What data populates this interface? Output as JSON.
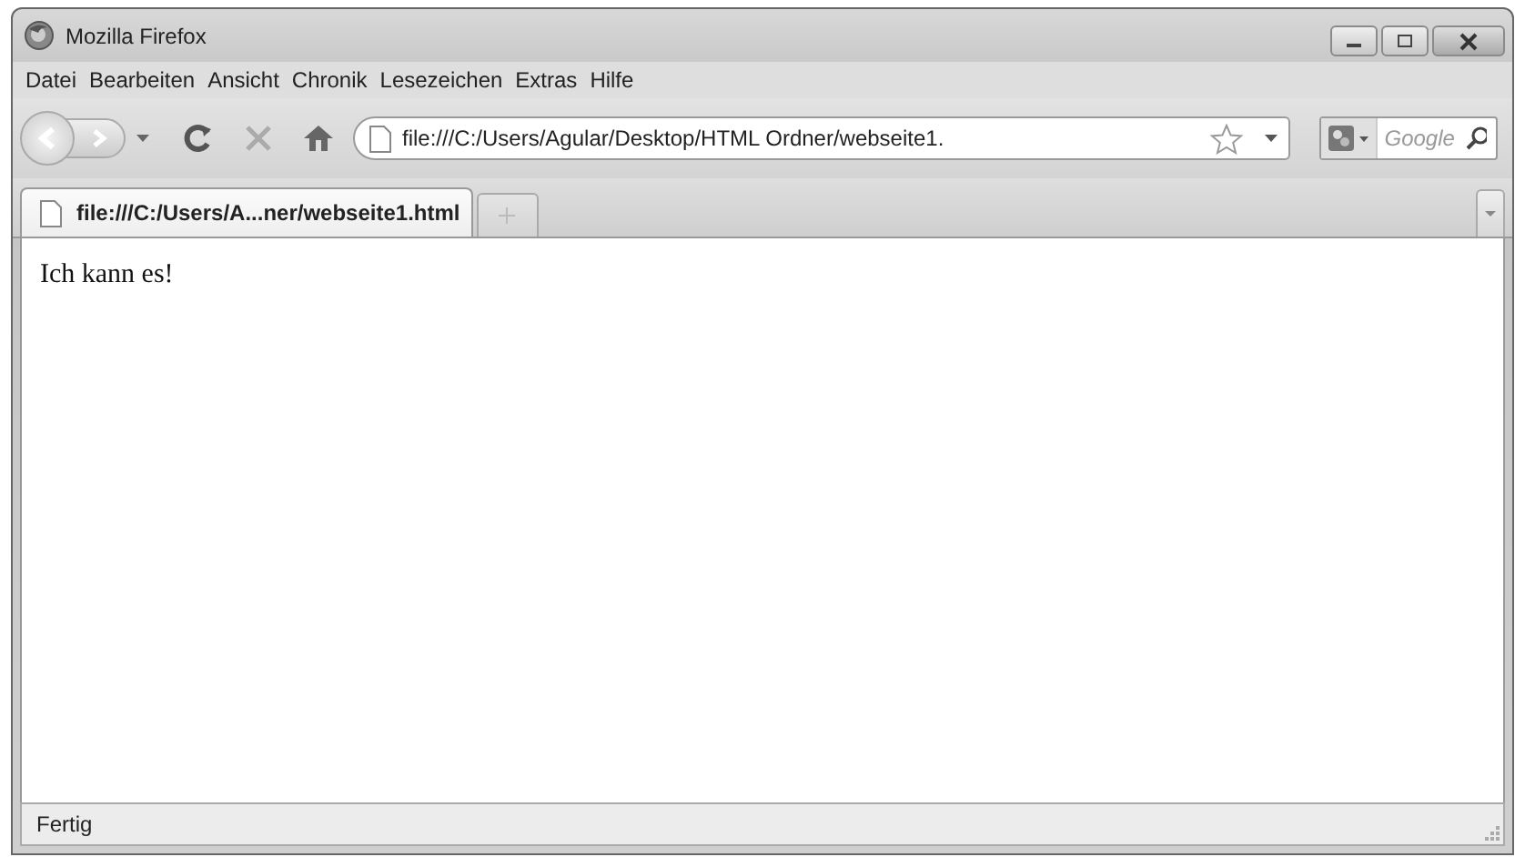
{
  "window": {
    "title": "Mozilla Firefox"
  },
  "menu": [
    "Datei",
    "Bearbeiten",
    "Ansicht",
    "Chronik",
    "Lesezeichen",
    "Extras",
    "Hilfe"
  ],
  "navigation": {
    "address": "file:///C:/Users/Agular/Desktop/HTML Ordner/webseite1.",
    "search": {
      "placeholder": "Google"
    }
  },
  "tabs": [
    {
      "label": "file:///C:/Users/A...ner/webseite1.html",
      "selected": true
    }
  ],
  "page": {
    "text": "Ich kann es!"
  },
  "status_bar": {
    "text": "Fertig"
  }
}
